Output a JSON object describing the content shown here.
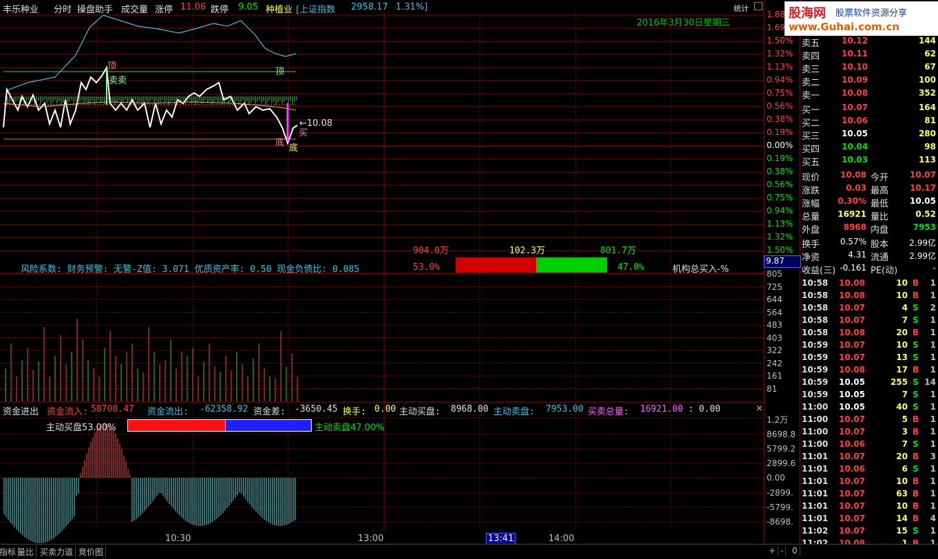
{
  "header": {
    "stock_name": "丰乐种业",
    "mode": "分时",
    "helper": "操盘助手",
    "volume_label": "成交量",
    "limit_up_label": "涨停",
    "limit_up_value": "11.06",
    "limit_down_label": "跌停",
    "limit_down_value": "9.05",
    "sector": "种植业",
    "index_name": "[上证指数",
    "index_value": "2958.17",
    "index_change": "1.31%]",
    "stats_button": "统计",
    "date_text": "2016年3月30日星期三"
  },
  "logo": {
    "brand": "股海网",
    "slogan": "股票软件资源分享",
    "url": "www.Guhai.com.cn"
  },
  "colors": {
    "up": "#ff4040",
    "down": "#00e000",
    "bg": "#000000",
    "grid": "#8b0000",
    "price_line": "#ffffff",
    "index_line": "#40c0e0"
  },
  "main_chart": {
    "annotations": {
      "top1": "顶",
      "sell": "卖卖",
      "top2": "顶",
      "bottom1": "底",
      "bottom2": "底",
      "buy": "买",
      "price_marker": "←10.08"
    },
    "axis_right_pct": [
      "1.88%",
      "1.69%",
      "1.50%",
      "1.32%",
      "1.13%",
      "0.94%",
      "0.75%",
      "0.56%",
      "0.38%",
      "0.19%",
      "0.00%",
      "0.19%",
      "0.38%",
      "0.56%",
      "0.75%",
      "0.94%",
      "1.13%",
      "1.32%",
      "1.50%"
    ],
    "axis_right_bottom": "9.87",
    "risk_text": "风险系数: 财务预警: 无警-Z值: 3.071 优质资产率: 0.50 现金负债比: 0.085",
    "flow_bar": {
      "left_amount": "904.0万",
      "mid_amount": "102.3万",
      "right_amount": "801.7万",
      "left_pct": "53.0%",
      "right_pct": "47.0%",
      "label": "机构总买入-%",
      "left_ratio": 0.53
    }
  },
  "volume_chart": {
    "axis": [
      "805",
      "725",
      "644",
      "564",
      "483",
      "403",
      "322",
      "242",
      "161",
      "81"
    ]
  },
  "capital_panel": {
    "title": "资金进出",
    "inflow_label": "资金流入:",
    "inflow": "58708.47",
    "outflow_label": "资金流出:",
    "outflow": "-62358.92",
    "diff_label": "资金差:",
    "diff": "-3650.45",
    "turnover_label": "换手:",
    "turnover": "0.00",
    "active_buy_label": "主动买盘:",
    "active_buy": "8968.00",
    "active_sell_label": "主动卖盘:",
    "active_sell": "7953.00",
    "total_label": "买卖总量:",
    "total": "16921.00",
    "extra": ": 0.00",
    "buy_bar_label": "主动买盘53.00%",
    "sell_bar_label": "主动卖盘47.00%",
    "buy_ratio": 0.53,
    "axis": [
      "1.2万",
      "8698.8",
      "5799.2",
      "2899.6",
      "0.00",
      "-2899.",
      "-5799.",
      "-8698."
    ],
    "close_icon": "×"
  },
  "time_axis": [
    "10:30",
    "13:00",
    "13:41",
    "14:00"
  ],
  "orderbook": {
    "sell": [
      {
        "label": "卖五",
        "price": "10.12",
        "vol": "144"
      },
      {
        "label": "卖四",
        "price": "10.11",
        "vol": "62"
      },
      {
        "label": "卖三",
        "price": "10.10",
        "vol": "67"
      },
      {
        "label": "卖二",
        "price": "10.09",
        "vol": "100"
      },
      {
        "label": "卖一",
        "price": "10.08",
        "vol": "352"
      }
    ],
    "buy": [
      {
        "label": "买一",
        "price": "10.07",
        "vol": "164",
        "color": "#ff4040"
      },
      {
        "label": "买二",
        "price": "10.06",
        "vol": "81",
        "color": "#ff4040"
      },
      {
        "label": "买三",
        "price": "10.05",
        "vol": "280",
        "color": "#ffffff"
      },
      {
        "label": "买四",
        "price": "10.04",
        "vol": "98",
        "color": "#00e000"
      },
      {
        "label": "买五",
        "price": "10.03",
        "vol": "113",
        "color": "#00e000"
      }
    ]
  },
  "quote": [
    {
      "l1": "现价",
      "v1": "10.08",
      "c1": "#ff4040",
      "l2": "今开",
      "v2": "10.07",
      "c2": "#ff4040"
    },
    {
      "l1": "涨跌",
      "v1": "0.03",
      "c1": "#ff4040",
      "l2": "最高",
      "v2": "10.17",
      "c2": "#ff4040"
    },
    {
      "l1": "涨幅",
      "v1": "0.30%",
      "c1": "#ff4040",
      "l2": "最低",
      "v2": "10.05",
      "c2": "#ffffff"
    },
    {
      "l1": "总量",
      "v1": "16921",
      "c1": "#ffff60",
      "l2": "量比",
      "v2": "0.52",
      "c2": "#ffff60"
    },
    {
      "l1": "外盘",
      "v1": "8968",
      "c1": "#ff4040",
      "l2": "内盘",
      "v2": "7953",
      "c2": "#00e000"
    }
  ],
  "fundamentals": [
    {
      "l1": "换手",
      "v1": "0.57%",
      "l2": "股本",
      "v2": "2.99亿"
    },
    {
      "l1": "净资",
      "v1": "4.31",
      "l2": "流通",
      "v2": "2.99亿"
    },
    {
      "l1": "收益(三)",
      "v1": "-0.161",
      "l2": "PE(动)",
      "v2": "-"
    }
  ],
  "ticks": [
    {
      "time": "10:58",
      "price": "10.08",
      "vol": "10",
      "side": "B",
      "n": "1"
    },
    {
      "time": "10:58",
      "price": "10.08",
      "vol": "10",
      "side": "B",
      "n": "1"
    },
    {
      "time": "10:58",
      "price": "10.07",
      "vol": "4",
      "side": "S",
      "n": "2"
    },
    {
      "time": "10:58",
      "price": "10.07",
      "vol": "7",
      "side": "S",
      "n": "1"
    },
    {
      "time": "10:58",
      "price": "10.08",
      "vol": "20",
      "side": "B",
      "n": "1"
    },
    {
      "time": "10:59",
      "price": "10.07",
      "vol": "10",
      "side": "S",
      "n": "1"
    },
    {
      "time": "10:59",
      "price": "10.07",
      "vol": "13",
      "side": "S",
      "n": "1"
    },
    {
      "time": "10:59",
      "price": "10.08",
      "vol": "17",
      "side": "B",
      "n": "1"
    },
    {
      "time": "10:59",
      "price": "10.05",
      "vol": "255",
      "side": "S",
      "n": "14"
    },
    {
      "time": "10:59",
      "price": "10.05",
      "vol": "7",
      "side": "S",
      "n": "1"
    },
    {
      "time": "11:00",
      "price": "10.05",
      "vol": "40",
      "side": "S",
      "n": "1"
    },
    {
      "time": "11:00",
      "price": "10.07",
      "vol": "5",
      "side": "B",
      "n": "1"
    },
    {
      "time": "11:00",
      "price": "10.07",
      "vol": "3",
      "side": "B",
      "n": "1"
    },
    {
      "time": "11:00",
      "price": "10.06",
      "vol": "7",
      "side": "S",
      "n": "1"
    },
    {
      "time": "11:01",
      "price": "10.07",
      "vol": "20",
      "side": "B",
      "n": "3"
    },
    {
      "time": "11:01",
      "price": "10.06",
      "vol": "6",
      "side": "S",
      "n": "1"
    },
    {
      "time": "11:01",
      "price": "10.07",
      "vol": "10",
      "side": "B",
      "n": "1"
    },
    {
      "time": "11:01",
      "price": "10.07",
      "vol": "63",
      "side": "B",
      "n": "1"
    },
    {
      "time": "11:01",
      "price": "10.07",
      "vol": "10",
      "side": "B",
      "n": "1"
    },
    {
      "time": "11:01",
      "price": "10.07",
      "vol": "14",
      "side": "B",
      "n": "4"
    },
    {
      "time": "11:02",
      "price": "10.07",
      "vol": "15",
      "side": "S",
      "n": "1"
    },
    {
      "time": "11:02",
      "price": "10.08",
      "vol": "1",
      "side": "B",
      "n": "1"
    }
  ],
  "bottom_tabs": [
    "指标",
    "量比",
    "买卖力道",
    "竞价图"
  ],
  "bottom_buttons": [
    "+",
    "-",
    "0"
  ]
}
